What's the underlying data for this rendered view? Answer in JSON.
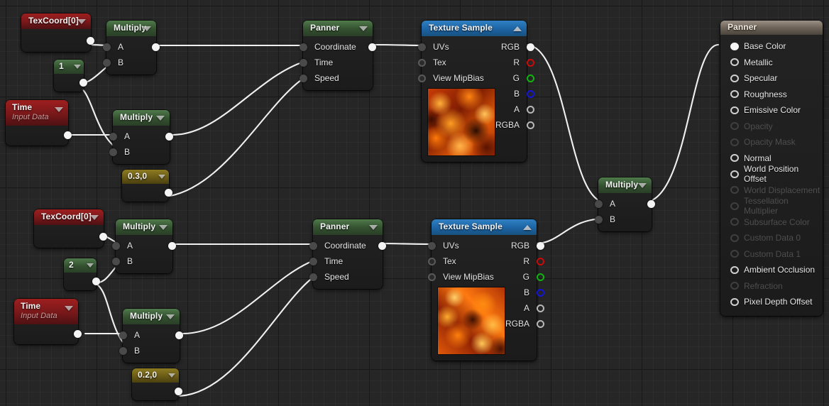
{
  "graph": {
    "title": "Material Editor Node Graph",
    "wire_color": "#f0f0f0",
    "background": "#262626"
  },
  "nodes": {
    "texcoord_top": {
      "title": "TexCoord[0]",
      "header_color": "#78181a"
    },
    "texcoord_bottom": {
      "title": "TexCoord[0]",
      "header_color": "#78181a"
    },
    "const_1": {
      "title": "1",
      "header_color": "#33502f"
    },
    "const_2": {
      "title": "2",
      "header_color": "#33502f"
    },
    "const_03_0": {
      "title": "0.3,0",
      "header_color": "#6b5c16"
    },
    "const_02_0": {
      "title": "0.2,0",
      "header_color": "#6b5c16"
    },
    "time_top": {
      "title": "Time",
      "subtitle": "Input Data",
      "header_color": "#78181a"
    },
    "time_bottom": {
      "title": "Time",
      "subtitle": "Input Data",
      "header_color": "#78181a"
    },
    "multiply": {
      "title": "Multiply",
      "header_color": "#33502f",
      "inputs": [
        "A",
        "B"
      ],
      "output": ""
    },
    "panner": {
      "title": "Panner",
      "header_color": "#33502f",
      "inputs": [
        "Coordinate",
        "Time",
        "Speed"
      ],
      "output": ""
    },
    "texture_sample": {
      "title": "Texture Sample",
      "header_color": "#1d63a3",
      "inputs": [
        "UVs",
        "Tex",
        "View MipBias"
      ],
      "outputs": [
        {
          "label": "RGB",
          "pin": "white-pin"
        },
        {
          "label": "R",
          "pin": "red-pin"
        },
        {
          "label": "G",
          "pin": "green-pin"
        },
        {
          "label": "B",
          "pin": "blue-pin"
        },
        {
          "label": "A",
          "pin": "grey-pin"
        },
        {
          "label": "RGBA",
          "pin": "grey-pin"
        }
      ],
      "preview": "lava-texture-thumbnail"
    },
    "material_output": {
      "title": "Panner",
      "header_color": "#6e6458",
      "pins": [
        {
          "label": "Base Color",
          "state": "connected"
        },
        {
          "label": "Metallic",
          "state": "enabled"
        },
        {
          "label": "Specular",
          "state": "enabled"
        },
        {
          "label": "Roughness",
          "state": "enabled"
        },
        {
          "label": "Emissive Color",
          "state": "enabled"
        },
        {
          "label": "Opacity",
          "state": "disabled"
        },
        {
          "label": "Opacity Mask",
          "state": "disabled"
        },
        {
          "label": "Normal",
          "state": "enabled"
        },
        {
          "label": "World Position Offset",
          "state": "enabled"
        },
        {
          "label": "World Displacement",
          "state": "disabled"
        },
        {
          "label": "Tessellation Multiplier",
          "state": "disabled"
        },
        {
          "label": "Subsurface Color",
          "state": "disabled"
        },
        {
          "label": "Custom Data 0",
          "state": "disabled"
        },
        {
          "label": "Custom Data 1",
          "state": "disabled"
        },
        {
          "label": "Ambient Occlusion",
          "state": "enabled"
        },
        {
          "label": "Refraction",
          "state": "disabled"
        },
        {
          "label": "Pixel Depth Offset",
          "state": "enabled"
        }
      ]
    }
  }
}
